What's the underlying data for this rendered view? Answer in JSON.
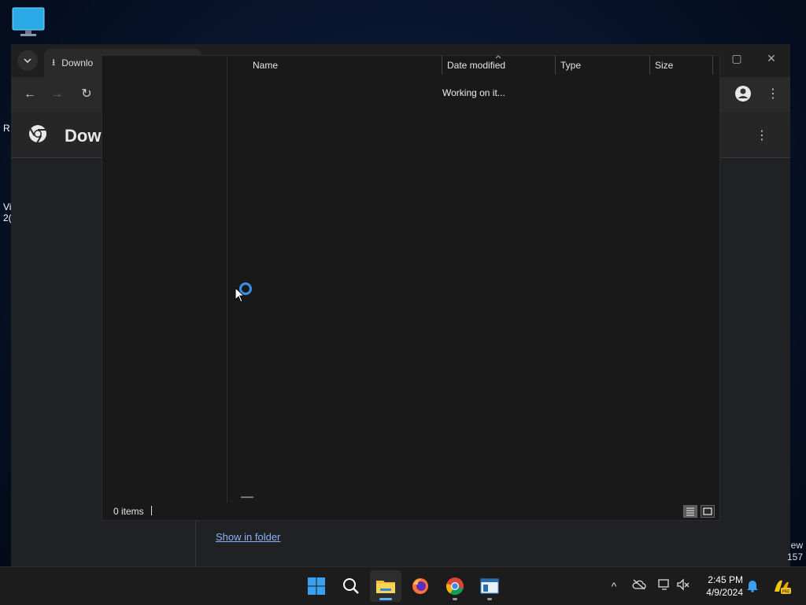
{
  "desktop": {
    "left_text_1": "R",
    "left_text_2a": "Vi",
    "left_text_2b": "2("
  },
  "chrome": {
    "tab_title": "Downlo",
    "page_title": "Dow",
    "show_in_folder": "Show in folder",
    "right_clip_1": "ew",
    "right_clip_2": "157"
  },
  "explorer": {
    "columns": [
      "Name",
      "Date modified",
      "Type",
      "Size"
    ],
    "working_text": "Working on it...",
    "status_items": "0 items"
  },
  "taskbar": {
    "apps": [
      "start-icon",
      "search-icon",
      "file-explorer-icon",
      "firefox-icon",
      "chrome-icon",
      "app-window-icon"
    ],
    "time": "2:45 PM",
    "date": "4/9/2024"
  },
  "colors": {
    "accent": "#3a8fe8",
    "link": "#8ab4f8"
  }
}
